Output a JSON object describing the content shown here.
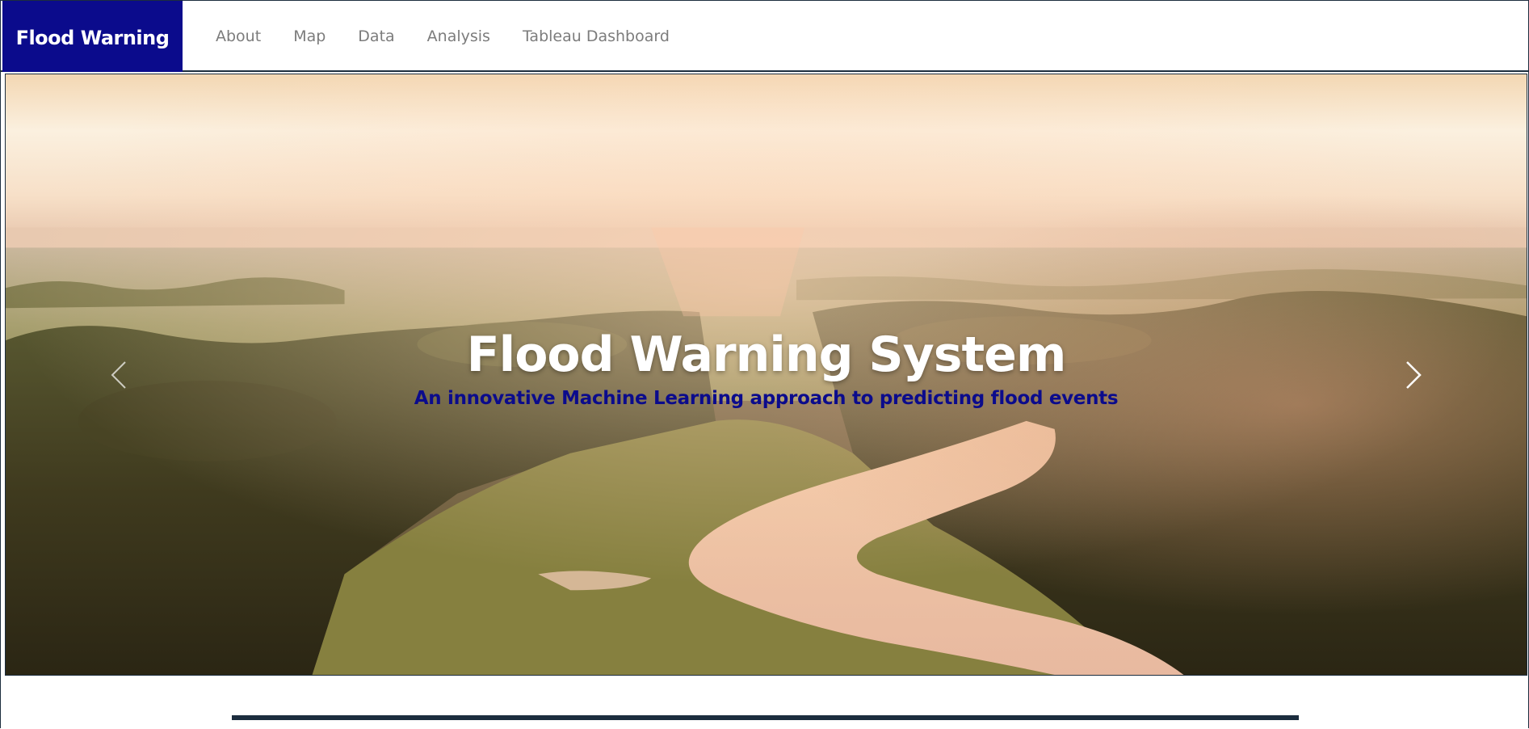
{
  "navbar": {
    "brand": "Flood Warning",
    "brand_bg": "#0b0b8c",
    "links": [
      {
        "label": "About"
      },
      {
        "label": "Map"
      },
      {
        "label": "Data"
      },
      {
        "label": "Analysis"
      },
      {
        "label": "Tableau Dashboard"
      }
    ]
  },
  "hero": {
    "title": "Flood Warning System",
    "subtitle": "An innovative Machine Learning approach to predicting flood events",
    "subtitle_color": "#0b0b8c",
    "prev_icon": "chevron-left-icon",
    "next_icon": "chevron-right-icon"
  }
}
